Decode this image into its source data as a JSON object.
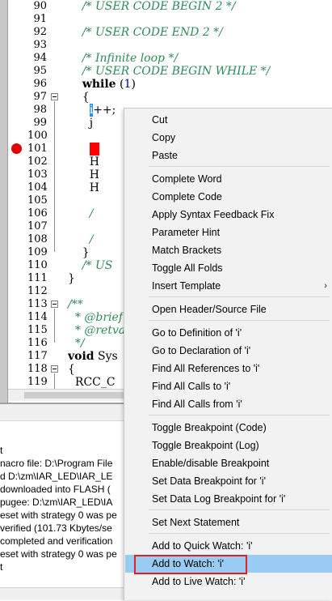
{
  "editor": {
    "lines": [
      {
        "num": "90",
        "fold": false,
        "code": [
          {
            "t": "    /* USER CODE BEGIN 2 */",
            "c": "cm"
          }
        ]
      },
      {
        "num": "91",
        "fold": false,
        "code": []
      },
      {
        "num": "92",
        "fold": false,
        "code": [
          {
            "t": "    /* USER CODE END 2 */",
            "c": "cm"
          }
        ]
      },
      {
        "num": "93",
        "fold": false,
        "code": []
      },
      {
        "num": "94",
        "fold": false,
        "code": [
          {
            "t": "    /* Infinite loop */",
            "c": "cm"
          }
        ]
      },
      {
        "num": "95",
        "fold": false,
        "code": [
          {
            "t": "    /* USER CODE BEGIN WHILE */",
            "c": "cm"
          }
        ]
      },
      {
        "num": "96",
        "fold": false,
        "code": [
          {
            "t": "    ",
            "c": ""
          },
          {
            "t": "while",
            "c": "kw"
          },
          {
            "t": " (",
            "c": ""
          },
          {
            "t": "1",
            "c": "num"
          },
          {
            "t": ")",
            "c": ""
          }
        ]
      },
      {
        "num": "97",
        "fold": true,
        "code": [
          {
            "t": "    {",
            "c": ""
          }
        ]
      },
      {
        "num": "98",
        "fold": false,
        "code": [
          {
            "t": "      ",
            "c": ""
          },
          {
            "t": "i",
            "c": "hl"
          },
          {
            "t": "++;",
            "c": ""
          }
        ]
      },
      {
        "num": "99",
        "fold": false,
        "code": [
          {
            "t": "      j",
            "c": ""
          }
        ]
      },
      {
        "num": "100",
        "fold": false,
        "code": []
      },
      {
        "num": "101",
        "fold": false,
        "code": [
          {
            "t": "      ",
            "c": ""
          },
          {
            "t": "H",
            "c": "redhl"
          }
        ]
      },
      {
        "num": "102",
        "fold": false,
        "code": [
          {
            "t": "      H",
            "c": ""
          }
        ]
      },
      {
        "num": "103",
        "fold": false,
        "code": [
          {
            "t": "      H",
            "c": ""
          }
        ]
      },
      {
        "num": "104",
        "fold": false,
        "code": [
          {
            "t": "      H",
            "c": ""
          }
        ]
      },
      {
        "num": "105",
        "fold": false,
        "code": []
      },
      {
        "num": "106",
        "fold": false,
        "code": [
          {
            "t": "      /",
            "c": "cm"
          }
        ]
      },
      {
        "num": "107",
        "fold": false,
        "code": []
      },
      {
        "num": "108",
        "fold": false,
        "code": [
          {
            "t": "      /",
            "c": "cm"
          }
        ]
      },
      {
        "num": "109",
        "fold": false,
        "code": [
          {
            "t": "    }",
            "c": ""
          }
        ]
      },
      {
        "num": "110",
        "fold": false,
        "code": [
          {
            "t": "    /* US",
            "c": "cm"
          }
        ]
      },
      {
        "num": "111",
        "fold": false,
        "code": [
          {
            "t": "}",
            "c": ""
          }
        ]
      },
      {
        "num": "112",
        "fold": false,
        "code": []
      },
      {
        "num": "113",
        "fold": true,
        "code": [
          {
            "t": "/**",
            "c": "cm"
          }
        ]
      },
      {
        "num": "114",
        "fold": false,
        "code": [
          {
            "t": "  * @brief",
            "c": "cm"
          }
        ]
      },
      {
        "num": "115",
        "fold": false,
        "code": [
          {
            "t": "  * @retval",
            "c": "cm"
          }
        ]
      },
      {
        "num": "116",
        "fold": false,
        "code": [
          {
            "t": "  */",
            "c": "cm"
          }
        ]
      },
      {
        "num": "117",
        "fold": false,
        "code": [
          {
            "t": "void",
            "c": "kw"
          },
          {
            "t": " Sys",
            "c": ""
          }
        ]
      },
      {
        "num": "118",
        "fold": true,
        "code": [
          {
            "t": "{",
            "c": ""
          }
        ]
      },
      {
        "num": "119",
        "fold": false,
        "code": [
          {
            "t": "  RCC_C",
            "c": ""
          }
        ]
      }
    ]
  },
  "output": {
    "lines": [
      "t",
      "nacro file: D:\\Program File",
      "d D:\\zm\\IAR_LED\\IAR_LE",
      "downloaded into FLASH (",
      "pugee: D:\\zm\\IAR_LED\\IA",
      "eset with strategy 0 was pe",
      "verified (101.73 Kbytes/se",
      "completed and verification",
      "eset with strategy 0 was pe",
      "t"
    ]
  },
  "context_menu": {
    "items": [
      {
        "label": "Cut",
        "sep_after": false
      },
      {
        "label": "Copy",
        "sep_after": false
      },
      {
        "label": "Paste",
        "sep_after": true
      },
      {
        "label": "Complete Word",
        "sep_after": false
      },
      {
        "label": "Complete Code",
        "sep_after": false
      },
      {
        "label": "Apply Syntax Feedback Fix",
        "sep_after": false
      },
      {
        "label": "Parameter Hint",
        "sep_after": false
      },
      {
        "label": "Match Brackets",
        "sep_after": false
      },
      {
        "label": "Toggle All Folds",
        "sep_after": false
      },
      {
        "label": "Insert Template",
        "sep_after": true,
        "submenu": true
      },
      {
        "label": "Open Header/Source File",
        "sep_after": true
      },
      {
        "label": "Go to Definition of 'i'",
        "sep_after": false
      },
      {
        "label": "Go to Declaration of 'i'",
        "sep_after": false
      },
      {
        "label": "Find All References to 'i'",
        "sep_after": false
      },
      {
        "label": "Find All Calls to 'i'",
        "sep_after": false
      },
      {
        "label": "Find All Calls from 'i'",
        "sep_after": true
      },
      {
        "label": "Toggle Breakpoint (Code)",
        "sep_after": false
      },
      {
        "label": "Toggle Breakpoint (Log)",
        "sep_after": false
      },
      {
        "label": "Enable/disable Breakpoint",
        "sep_after": false
      },
      {
        "label": "Set Data Breakpoint for 'i'",
        "sep_after": false
      },
      {
        "label": "Set Data Log Breakpoint for 'i'",
        "sep_after": true
      },
      {
        "label": "Set Next Statement",
        "sep_after": true
      },
      {
        "label": "Add to Quick Watch: 'i'",
        "sep_after": false
      },
      {
        "label": "Add to Watch: 'i'",
        "sep_after": false,
        "active": true
      },
      {
        "label": "Add to Live Watch: 'i'",
        "sep_after": false
      }
    ],
    "submenu_arrow": "›"
  },
  "colors": {
    "comment": "#2e8b57",
    "breakpoint": "#e00000",
    "menu_highlight": "#99ccf2",
    "focus_box": "#e02020"
  }
}
